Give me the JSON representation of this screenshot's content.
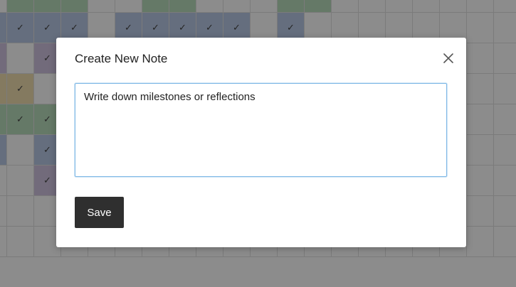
{
  "modal": {
    "title": "Create New Note",
    "note_text": "Write down milestones or reflections",
    "save_label": "Save",
    "close_icon": "close-icon"
  },
  "grid": {
    "check_glyph": "✓",
    "colors": {
      "green": "#b9dcbc",
      "blue": "#b9c9e6",
      "purple": "#cfc3e0",
      "yellow": "#f1dfb0"
    },
    "rows": [
      [
        "white",
        "green",
        "green",
        "green",
        "white",
        "white",
        "green",
        "green",
        "white",
        "white",
        "white",
        "green",
        "green",
        "white",
        "white",
        "white",
        "white",
        "white",
        "white",
        "white"
      ],
      [
        "blue",
        "blue",
        "blue",
        "blue",
        "white",
        "blue",
        "blue",
        "blue",
        "blue",
        "blue",
        "white",
        "blue",
        "white",
        "white",
        "white",
        "white",
        "white",
        "white",
        "white",
        "white"
      ],
      [
        "purple",
        "white",
        "purple",
        "white",
        "white",
        "white",
        "white",
        "white",
        "white",
        "white",
        "white",
        "white",
        "white",
        "white",
        "white",
        "white",
        "white",
        "white",
        "white",
        "white"
      ],
      [
        "yellow",
        "yellow",
        "white",
        "white",
        "white",
        "white",
        "white",
        "white",
        "white",
        "white",
        "white",
        "white",
        "white",
        "white",
        "white",
        "white",
        "white",
        "white",
        "white",
        "white"
      ],
      [
        "green",
        "green",
        "green",
        "white",
        "white",
        "white",
        "white",
        "white",
        "white",
        "white",
        "white",
        "white",
        "white",
        "white",
        "white",
        "white",
        "white",
        "white",
        "white",
        "white"
      ],
      [
        "blue",
        "white",
        "blue",
        "white",
        "white",
        "white",
        "white",
        "white",
        "white",
        "white",
        "white",
        "white",
        "white",
        "white",
        "white",
        "white",
        "white",
        "white",
        "white",
        "white"
      ],
      [
        "white",
        "white",
        "purple",
        "white",
        "white",
        "white",
        "white",
        "white",
        "white",
        "white",
        "white",
        "white",
        "white",
        "white",
        "white",
        "white",
        "white",
        "white",
        "white",
        "white"
      ],
      [
        "white",
        "white",
        "white",
        "white",
        "white",
        "white",
        "white",
        "white",
        "white",
        "white",
        "white",
        "white",
        "white",
        "white",
        "white",
        "white",
        "white",
        "white",
        "white",
        "white"
      ],
      [
        "white",
        "white",
        "white",
        "white",
        "white",
        "white",
        "white",
        "white",
        "white",
        "white",
        "white",
        "white",
        "white",
        "white",
        "white",
        "white",
        "white",
        "white",
        "white",
        "white"
      ]
    ],
    "checks": [
      [],
      [
        1,
        2,
        3,
        5,
        6,
        7,
        8,
        9,
        11
      ],
      [
        2
      ],
      [
        1
      ],
      [
        1,
        2
      ],
      [
        2
      ],
      [
        2
      ],
      [],
      []
    ]
  }
}
